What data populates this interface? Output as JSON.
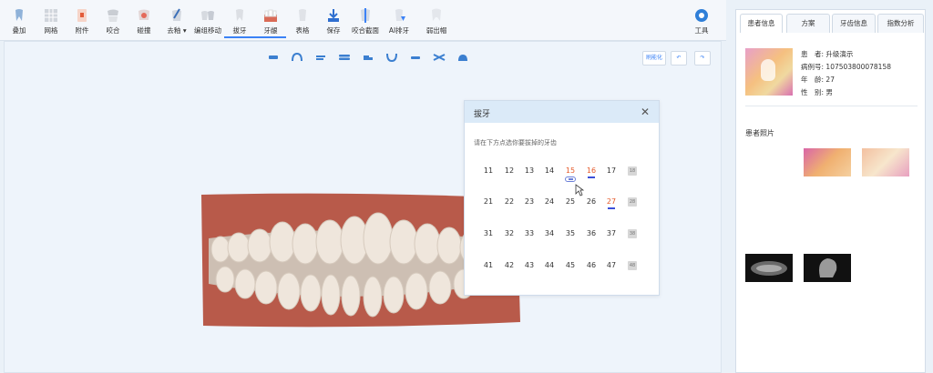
{
  "toolbar": {
    "items": [
      {
        "label": "叠加",
        "icon": "tooth-overlay-icon"
      },
      {
        "label": "网格",
        "icon": "grid-icon"
      },
      {
        "label": "附件",
        "icon": "attachment-icon"
      },
      {
        "label": "咬合",
        "icon": "occlusion-icon"
      },
      {
        "label": "碰撞",
        "icon": "collision-icon"
      },
      {
        "label": "去釉",
        "icon": "enamel-strip-icon"
      },
      {
        "label": "编组移动",
        "icon": "group-move-icon"
      },
      {
        "label": "拔牙",
        "icon": "extraction-icon"
      },
      {
        "label": "牙龈",
        "icon": "gingiva-icon"
      },
      {
        "label": "表格",
        "icon": "table-icon"
      },
      {
        "label": "保存",
        "icon": "save-icon"
      },
      {
        "label": "咬合截面",
        "icon": "occlusion-section-icon"
      },
      {
        "label": "AI排牙",
        "icon": "ai-arrange-icon"
      },
      {
        "label": "弱出帽",
        "icon": "tooth-cap-icon"
      }
    ],
    "tools_label": "工具"
  },
  "viewport": {
    "top_button_label": "刷能化",
    "view_icons": [
      "front-view-icon",
      "upper-arch-icon",
      "right-view-icon",
      "jaw-open-icon",
      "left-view-icon",
      "lower-arch-icon",
      "bottom-view-icon",
      "split-view-icon",
      "back-view-icon"
    ]
  },
  "dialog": {
    "title": "拔牙",
    "hint": "请在下方点选你要拔掉的牙齿",
    "rows": [
      [
        "11",
        "12",
        "13",
        "14",
        "15",
        "16",
        "17"
      ],
      [
        "21",
        "22",
        "23",
        "24",
        "25",
        "26",
        "27"
      ],
      [
        "31",
        "32",
        "33",
        "34",
        "35",
        "36",
        "37"
      ],
      [
        "41",
        "42",
        "43",
        "44",
        "45",
        "46",
        "47"
      ]
    ],
    "selected": [
      "15",
      "16",
      "27"
    ],
    "row_end_icon": "tooth-18-icon"
  },
  "panel": {
    "tabs": [
      "患者信息",
      "方案",
      "牙齿信息",
      "指数分析"
    ],
    "active_tab": "患者信息",
    "patient": {
      "name_label": "患　者:",
      "name": "升级演示",
      "id_label": "病例号:",
      "id": "107503800078158",
      "age_label": "年　龄:",
      "age": "27",
      "gender_label": "性　别:",
      "gender": "男"
    },
    "photos_label": "患者照片"
  },
  "colors": {
    "accent": "#3b82f6",
    "selected_tooth": "#e55a2b",
    "gum": "#b85a4a",
    "tooth": "#efe6dc"
  }
}
